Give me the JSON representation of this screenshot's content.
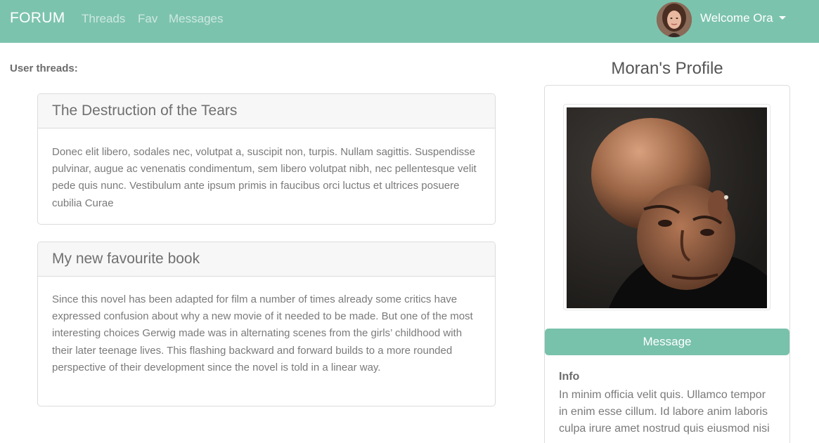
{
  "navbar": {
    "brand": "FORUM",
    "links": [
      "Threads",
      "Fav",
      "Messages"
    ],
    "welcome": "Welcome Ora",
    "bg_color": "#7cc3ad"
  },
  "threads_section": {
    "label": "User threads:",
    "threads": [
      {
        "title": "The Destruction of the Tears",
        "body": "Donec elit libero, sodales nec, volutpat a, suscipit non, turpis. Nullam sagittis. Suspendisse pulvinar, augue ac venenatis condimentum, sem libero volutpat nibh, nec pellentesque velit pede quis nunc. Vestibulum ante ipsum primis in faucibus orci luctus et ultrices posuere cubilia Curae"
      },
      {
        "title": "My new favourite book",
        "body": "Since this novel has been adapted for film a number of times already some critics have expressed confusion about why a new movie of it needed to be made. But one of the most interesting choices Gerwig made was in alternating scenes from the girls’ childhood with their later teenage lives. This flashing backward and forward builds to a more rounded perspective of their development since the novel is told in a linear way."
      }
    ]
  },
  "profile": {
    "title": "Moran's Profile",
    "message_button": "Message",
    "info_label": "Info",
    "info_text": "In minim officia velit quis. Ullamco tempor in enim esse cillum. Id labore anim laboris culpa irure amet nostrud quis eiusmod nisi",
    "accent_color": "#78c1ab"
  }
}
